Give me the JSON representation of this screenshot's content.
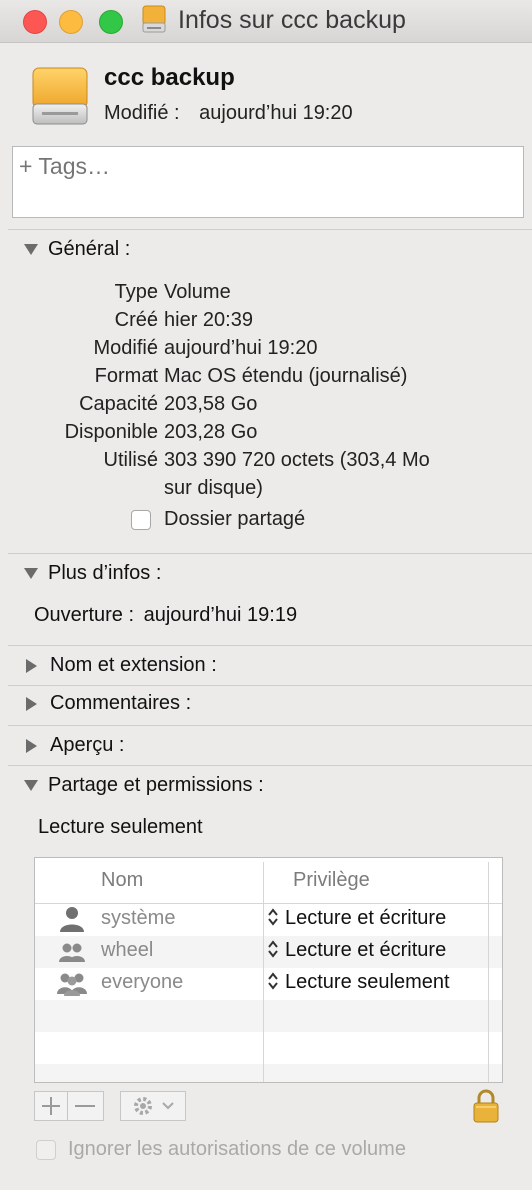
{
  "window": {
    "title": "Infos sur ccc backup"
  },
  "header": {
    "name": "ccc backup",
    "modified_label": "Modifié :",
    "modified_value": "aujourd’hui 19:20"
  },
  "tags": {
    "placeholder": "+ Tags…"
  },
  "general": {
    "title": "Général :",
    "rows": [
      {
        "label": "Type",
        "value": "Volume"
      },
      {
        "label": "Créé",
        "value": "hier 20:39"
      },
      {
        "label": "Modifié",
        "value": "aujourd’hui 19:20"
      },
      {
        "label": "Format",
        "value": "Mac OS étendu (journalisé)"
      },
      {
        "label": "Capacité",
        "value": "203,58 Go"
      },
      {
        "label": "Disponible",
        "value": "203,28 Go"
      },
      {
        "label": "Utilisé",
        "value": "303 390 720 octets (303,4 Mo",
        "value2": "sur disque)"
      }
    ],
    "shared_folder_label": "Dossier partagé"
  },
  "more_info": {
    "title": "Plus d’infos :",
    "opened_label": "Ouverture :",
    "opened_value": "aujourd’hui 19:19"
  },
  "name_extension": {
    "title": "Nom et extension :"
  },
  "comments": {
    "title": "Commentaires :"
  },
  "preview": {
    "title": "Aperçu :"
  },
  "sharing": {
    "title": "Partage et permissions :",
    "status": "Lecture seulement",
    "columns": {
      "name": "Nom",
      "privilege": "Privilège"
    },
    "rows": [
      {
        "name": "système",
        "privilege": "Lecture et écriture",
        "icon": "user-icon"
      },
      {
        "name": "wheel",
        "privilege": "Lecture et écriture",
        "icon": "group-icon"
      },
      {
        "name": "everyone",
        "privilege": "Lecture seulement",
        "icon": "everyone-icon"
      }
    ],
    "ignore_label": "Ignorer les autorisations de ce volume"
  },
  "colors": {
    "close": "#fc5753",
    "minimize": "#fdbc40",
    "maximize": "#33c748",
    "drive": "#f3b43a"
  }
}
